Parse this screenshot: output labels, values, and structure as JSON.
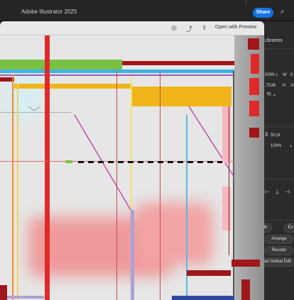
{
  "app": {
    "title": "Adobe Illustrator 2025",
    "share_label": "Share"
  },
  "doc_toolbar": {
    "open_preview_label": "Open with Preview"
  },
  "right_panel": {
    "tab_label": "Libraries",
    "x_value": "5099 c",
    "y_value": ",7538",
    "w_label": "W",
    "h_label": "H",
    "w_value": "0",
    "h_value": "24",
    "font_size_value": "50 pt",
    "zoom_value": "100%",
    "arrange_label": "Arrange",
    "recolor_label": "Recolor",
    "global_edit_label": "art Global Edit",
    "edit_short": "Ex",
    "path_short": "th"
  }
}
